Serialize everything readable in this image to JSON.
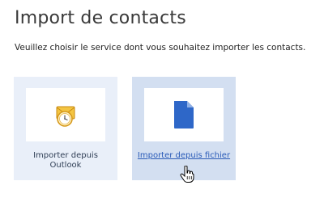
{
  "title": "Import de contacts",
  "subtitle": "Veuillez choisir le service dont vous souhaitez importer les contacts.",
  "options": [
    {
      "label": "Importer depuis Outlook",
      "icon": "outlook-icon"
    },
    {
      "label": "Importer depuis fichier",
      "icon": "file-icon"
    }
  ],
  "colors": {
    "card_bg": "#e9eff9",
    "card_hover_bg": "#d3dff1",
    "file_icon": "#2e67c8",
    "link": "#2a5bb8"
  }
}
